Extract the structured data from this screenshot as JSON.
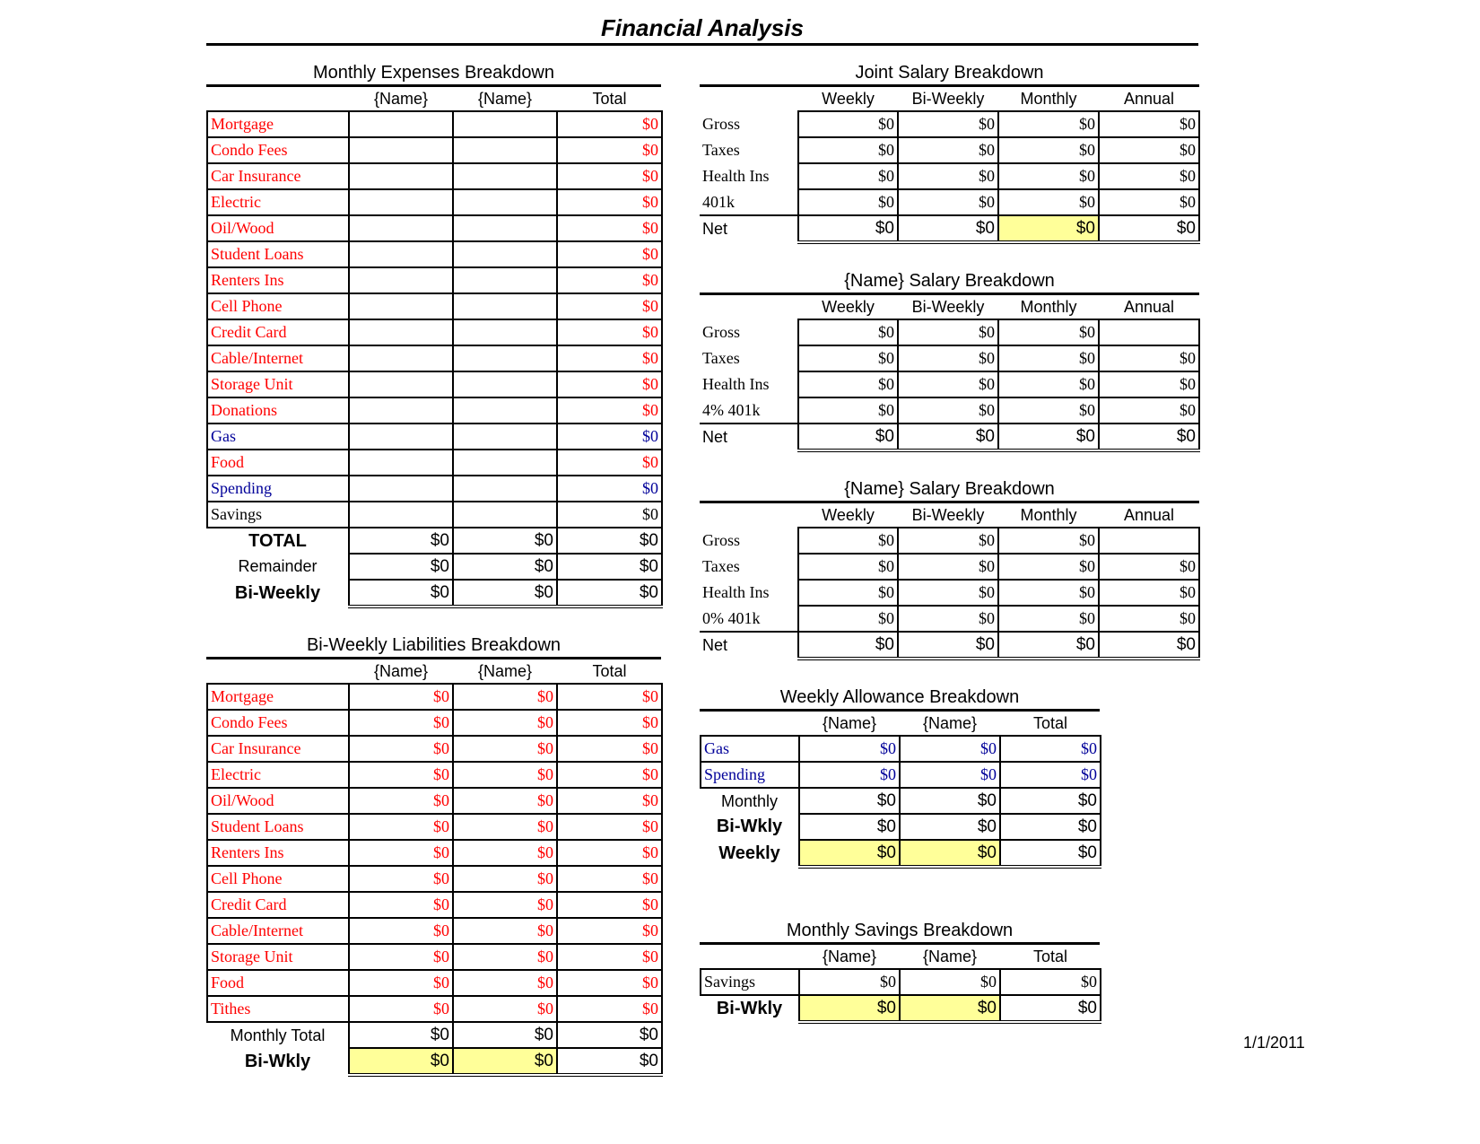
{
  "title": "Financial Analysis",
  "date": "1/1/2011",
  "colors": {
    "expense_red": "#ff0000",
    "allowance_blue": "#000099",
    "highlight_yellow": "#ffff99"
  },
  "monthly_expenses": {
    "title": "Monthly Expenses Breakdown",
    "headers": [
      "",
      "{Name}",
      "{Name}",
      "Total"
    ],
    "rows": [
      {
        "label": "Mortgage",
        "color": "red",
        "total": "$0"
      },
      {
        "label": "Condo Fees",
        "color": "red",
        "total": "$0"
      },
      {
        "label": "Car Insurance",
        "color": "red",
        "total": "$0"
      },
      {
        "label": "Electric",
        "color": "red",
        "total": "$0"
      },
      {
        "label": "Oil/Wood",
        "color": "red",
        "total": "$0"
      },
      {
        "label": "Student Loans",
        "color": "red",
        "total": "$0"
      },
      {
        "label": "Renters Ins",
        "color": "red",
        "total": "$0"
      },
      {
        "label": "Cell Phone",
        "color": "red",
        "total": "$0"
      },
      {
        "label": "Credit Card",
        "color": "red",
        "total": "$0"
      },
      {
        "label": "Cable/Internet",
        "color": "red",
        "total": "$0"
      },
      {
        "label": "Storage Unit",
        "color": "red",
        "total": "$0"
      },
      {
        "label": "Donations",
        "color": "red",
        "total": "$0"
      },
      {
        "label": "Gas",
        "color": "blue",
        "total": "$0"
      },
      {
        "label": "Food",
        "color": "red",
        "total": "$0"
      },
      {
        "label": "Spending",
        "color": "blue",
        "total": "$0"
      },
      {
        "label": "Savings",
        "color": "black",
        "total": "$0"
      }
    ],
    "summary": [
      {
        "label": "TOTAL",
        "values": [
          "$0",
          "$0",
          "$0"
        ]
      },
      {
        "label": "Remainder",
        "values": [
          "$0",
          "$0",
          "$0"
        ]
      },
      {
        "label": "Bi-Weekly",
        "values": [
          "$0",
          "$0",
          "$0"
        ]
      }
    ]
  },
  "liabilities": {
    "title": "Bi-Weekly Liabilities Breakdown",
    "headers": [
      "",
      "{Name}",
      "{Name}",
      "Total"
    ],
    "rows": [
      {
        "label": "Mortgage",
        "values": [
          "$0",
          "$0",
          "$0"
        ]
      },
      {
        "label": "Condo Fees",
        "values": [
          "$0",
          "$0",
          "$0"
        ]
      },
      {
        "label": "Car Insurance",
        "values": [
          "$0",
          "$0",
          "$0"
        ]
      },
      {
        "label": "Electric",
        "values": [
          "$0",
          "$0",
          "$0"
        ]
      },
      {
        "label": "Oil/Wood",
        "values": [
          "$0",
          "$0",
          "$0"
        ]
      },
      {
        "label": "Student Loans",
        "values": [
          "$0",
          "$0",
          "$0"
        ]
      },
      {
        "label": "Renters Ins",
        "values": [
          "$0",
          "$0",
          "$0"
        ]
      },
      {
        "label": "Cell Phone",
        "values": [
          "$0",
          "$0",
          "$0"
        ]
      },
      {
        "label": "Credit Card",
        "values": [
          "$0",
          "$0",
          "$0"
        ]
      },
      {
        "label": "Cable/Internet",
        "values": [
          "$0",
          "$0",
          "$0"
        ]
      },
      {
        "label": "Storage Unit",
        "values": [
          "$0",
          "$0",
          "$0"
        ]
      },
      {
        "label": "Food",
        "values": [
          "$0",
          "$0",
          "$0"
        ]
      },
      {
        "label": "Tithes",
        "values": [
          "$0",
          "$0",
          "$0"
        ]
      }
    ],
    "summary": [
      {
        "label": "Monthly Total",
        "values": [
          "$0",
          "$0",
          "$0"
        ]
      },
      {
        "label": "Bi-Wkly",
        "values": [
          "$0",
          "$0",
          "$0"
        ]
      }
    ]
  },
  "joint_salary": {
    "title": "Joint Salary Breakdown",
    "headers": [
      "",
      "Weekly",
      "Bi-Weekly",
      "Monthly",
      "Annual"
    ],
    "rows": [
      {
        "label": "Gross",
        "values": [
          "$0",
          "$0",
          "$0",
          "$0"
        ]
      },
      {
        "label": "Taxes",
        "values": [
          "$0",
          "$0",
          "$0",
          "$0"
        ]
      },
      {
        "label": "Health Ins",
        "values": [
          "$0",
          "$0",
          "$0",
          "$0"
        ]
      },
      {
        "label": "401k",
        "values": [
          "$0",
          "$0",
          "$0",
          "$0"
        ]
      }
    ],
    "net": {
      "label": "Net",
      "values": [
        "$0",
        "$0",
        "$0",
        "$0"
      ]
    }
  },
  "salary_a": {
    "title": "{Name} Salary Breakdown",
    "headers": [
      "",
      "Weekly",
      "Bi-Weekly",
      "Monthly",
      "Annual"
    ],
    "rows": [
      {
        "label": "Gross",
        "values": [
          "$0",
          "$0",
          "$0",
          ""
        ]
      },
      {
        "label": "Taxes",
        "values": [
          "$0",
          "$0",
          "$0",
          "$0"
        ]
      },
      {
        "label": "Health Ins",
        "values": [
          "$0",
          "$0",
          "$0",
          "$0"
        ]
      },
      {
        "label": "4% 401k",
        "values": [
          "$0",
          "$0",
          "$0",
          "$0"
        ]
      }
    ],
    "net": {
      "label": "Net",
      "values": [
        "$0",
        "$0",
        "$0",
        "$0"
      ]
    }
  },
  "salary_b": {
    "title": "{Name} Salary Breakdown",
    "headers": [
      "",
      "Weekly",
      "Bi-Weekly",
      "Monthly",
      "Annual"
    ],
    "rows": [
      {
        "label": "Gross",
        "values": [
          "$0",
          "$0",
          "$0",
          ""
        ]
      },
      {
        "label": "Taxes",
        "values": [
          "$0",
          "$0",
          "$0",
          "$0"
        ]
      },
      {
        "label": "Health Ins",
        "values": [
          "$0",
          "$0",
          "$0",
          "$0"
        ]
      },
      {
        "label": "0% 401k",
        "values": [
          "$0",
          "$0",
          "$0",
          "$0"
        ]
      }
    ],
    "net": {
      "label": "Net",
      "values": [
        "$0",
        "$0",
        "$0",
        "$0"
      ]
    }
  },
  "allowance": {
    "title": "Weekly Allowance Breakdown",
    "headers": [
      "",
      "{Name}",
      "{Name}",
      "Total"
    ],
    "rows": [
      {
        "label": "Gas",
        "values": [
          "$0",
          "$0",
          "$0"
        ]
      },
      {
        "label": "Spending",
        "values": [
          "$0",
          "$0",
          "$0"
        ]
      }
    ],
    "summary": [
      {
        "label": "Monthly",
        "values": [
          "$0",
          "$0",
          "$0"
        ]
      },
      {
        "label": "Bi-Wkly",
        "values": [
          "$0",
          "$0",
          "$0"
        ]
      },
      {
        "label": "Weekly",
        "values": [
          "$0",
          "$0",
          "$0"
        ]
      }
    ]
  },
  "savings": {
    "title": "Monthly Savings Breakdown",
    "headers": [
      "",
      "{Name}",
      "{Name}",
      "Total"
    ],
    "rows": [
      {
        "label": "Savings",
        "values": [
          "$0",
          "$0",
          "$0"
        ]
      }
    ],
    "summary": [
      {
        "label": "Bi-Wkly",
        "values": [
          "$0",
          "$0",
          "$0"
        ]
      }
    ]
  }
}
